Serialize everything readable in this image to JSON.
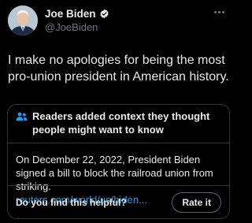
{
  "author": {
    "name": "Joe Biden",
    "handle": "@JoeBiden",
    "verified": true,
    "avatar_icon": "portrait-avatar"
  },
  "menu_icon": "more-horizontal-icon",
  "tweet": {
    "text": "I make no apologies for being the most pro-union president in American history."
  },
  "community_note": {
    "header_icon": "people-icon",
    "header": "Readers added context they thought people might want to know",
    "body": "On December 22, 2022, President Biden signed a bill to block the railroad union from striking.",
    "link": "reuters.com/world/us/biden...",
    "footer_question": "Do you find this helpful?",
    "rate_label": "Rate it"
  },
  "colors": {
    "background": "#000000",
    "text": "#e7e9ea",
    "secondary_text": "#71767b",
    "link": "#1d9bf0",
    "border": "#2f3336",
    "verified_badge": "#1d9bf0"
  }
}
